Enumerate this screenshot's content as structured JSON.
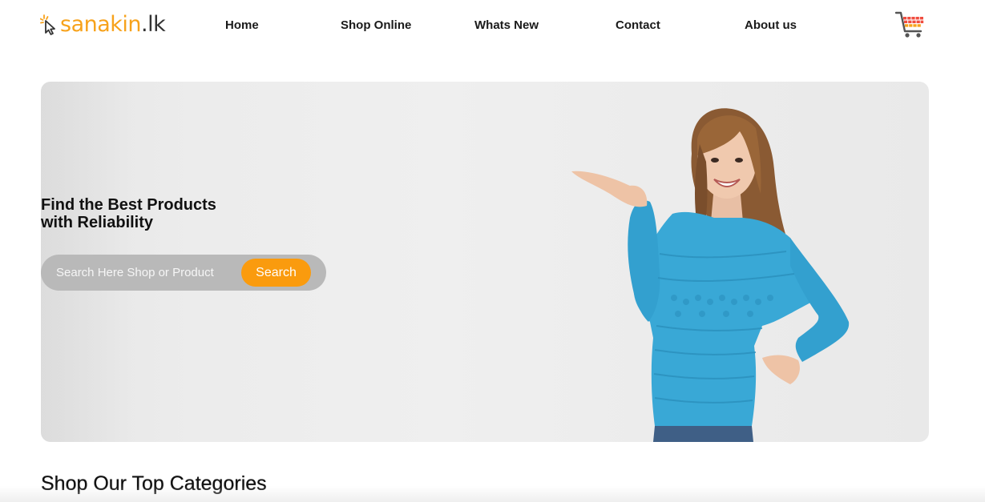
{
  "brand": {
    "logo_main": "sanakin",
    "logo_tld": ".lk",
    "accent_color": "#f7a21b",
    "dark_color": "#333333"
  },
  "nav": {
    "items": [
      {
        "label": "Home"
      },
      {
        "label": "Shop Online"
      },
      {
        "label": "Whats New"
      },
      {
        "label": "Contact"
      },
      {
        "label": "About us"
      }
    ]
  },
  "header": {
    "cart_icon": "shopping-cart-icon"
  },
  "hero": {
    "title_line1": "Find the Best Products",
    "title_line2": "with Reliability",
    "search": {
      "placeholder": "Search Here Shop or Product",
      "value": "",
      "button_label": "Search",
      "button_color": "#fa9b0e",
      "bar_color": "#b9b9b9"
    },
    "image_subject": "woman-in-blue-sweater"
  },
  "categories": {
    "title": "Shop Our Top Categories"
  }
}
